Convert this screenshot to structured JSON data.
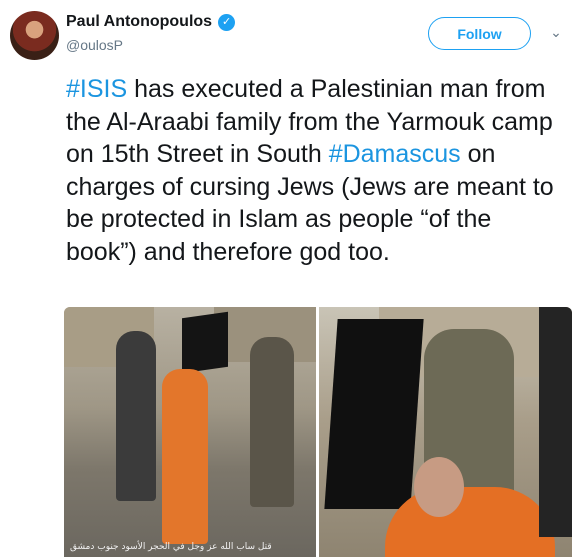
{
  "tweet": {
    "author_name": "Paul Antonopoulos",
    "handle": "@oulosP",
    "follow_label": "Follow",
    "text_parts": [
      {
        "type": "hashtag",
        "text": "#ISIS"
      },
      {
        "type": "text",
        "text": " has executed a Palestinian man from the Al-Araabi family from the Yarmouk camp on 15th Street in South "
      },
      {
        "type": "hashtag",
        "text": "#Damascus"
      },
      {
        "type": "text",
        "text": " on charges of cursing Jews (Jews are meant to be protected in Islam as people “of the book”) and therefore god too."
      }
    ]
  },
  "media": {
    "left_photo_caption": "قتل ساب الله عز وجل في الحجر الأسود جنوب دمشق"
  },
  "icons": {
    "verified": "verified-badge-icon",
    "chevron": "chevron-down-icon"
  },
  "colors": {
    "accent": "#1da1f2",
    "hashtag": "#1b95e0",
    "text": "#14171a",
    "secondary": "#657786"
  }
}
